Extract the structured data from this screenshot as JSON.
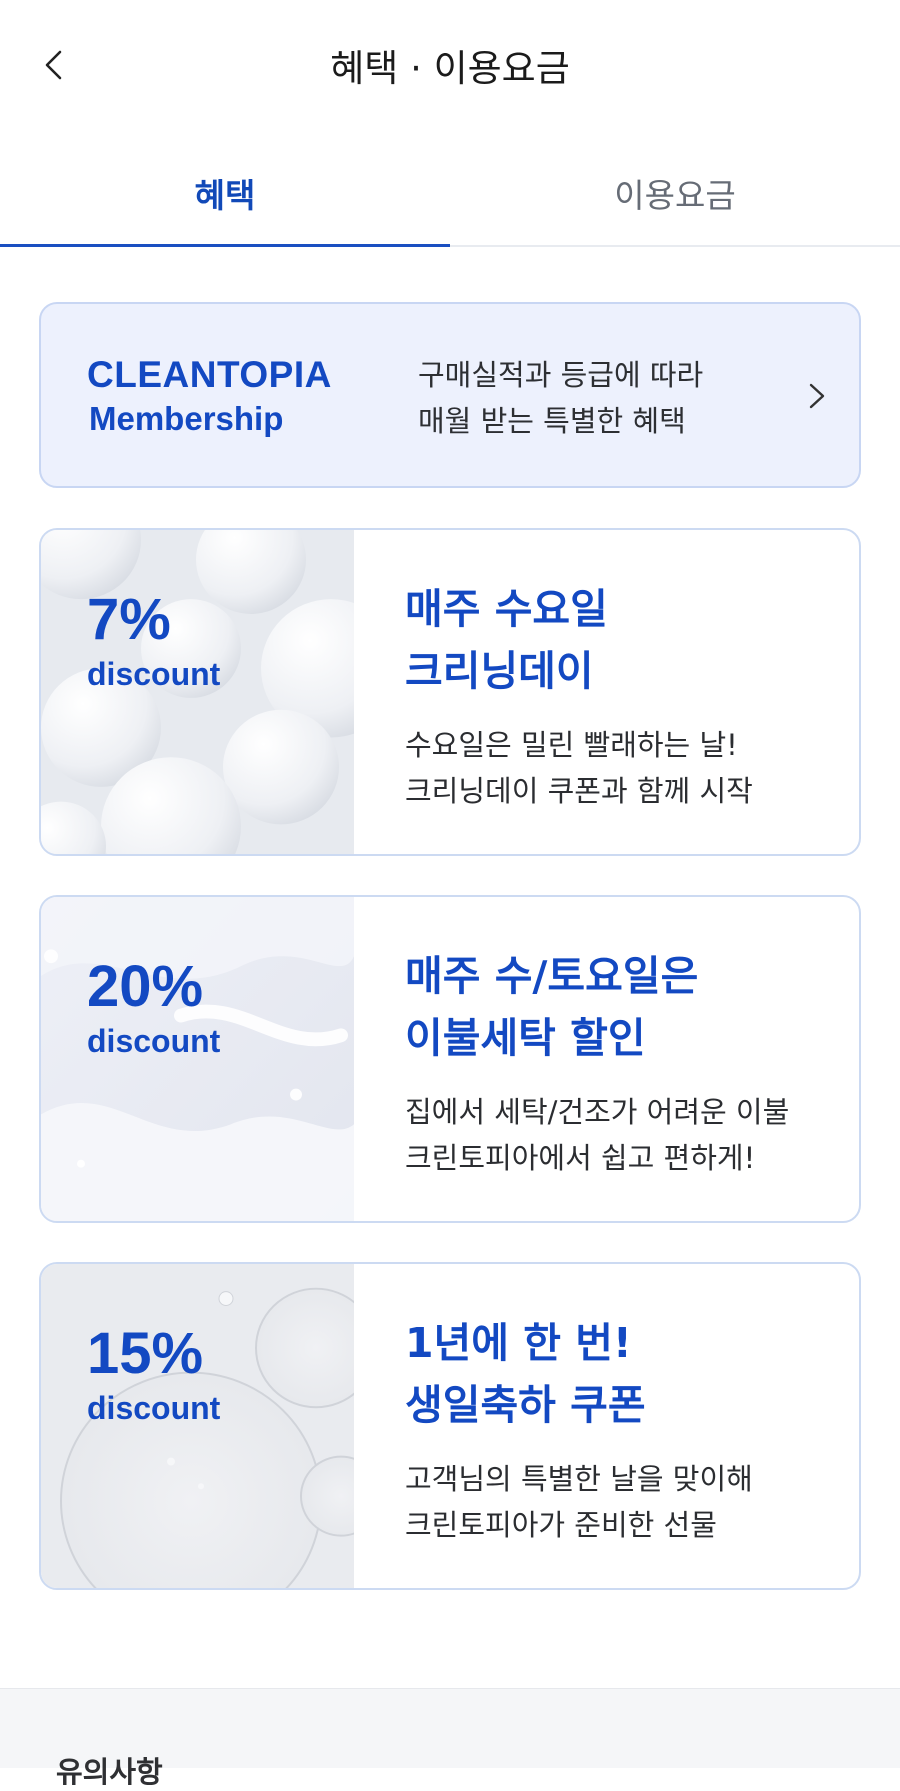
{
  "header": {
    "title": "혜택 · 이용요금",
    "back_icon": "chevron-left-icon"
  },
  "tabs": [
    {
      "label": "혜택",
      "active": true
    },
    {
      "label": "이용요금",
      "active": false
    }
  ],
  "membership": {
    "brand_line1": "CLEANTOPIA",
    "brand_line2": "Membership",
    "desc_line1": "구매실적과 등급에 따라",
    "desc_line2": "매월 받는 특별한 혜택",
    "chevron_icon": "chevron-right-icon"
  },
  "cards": [
    {
      "percent": "7%",
      "discount_label": "discount",
      "title_line1": "매주 수요일",
      "title_line2": "크리닝데이",
      "desc_line1": "수요일은 밀린 빨래하는 날!",
      "desc_line2": "크리닝데이 쿠폰과 함께 시작"
    },
    {
      "percent": "20%",
      "discount_label": "discount",
      "title_line1": "매주 수/토요일은",
      "title_line2": "이불세탁 할인",
      "desc_line1": "집에서 세탁/건조가 어려운 이불",
      "desc_line2": "크린토피아에서 쉽고 편하게!"
    },
    {
      "percent": "15%",
      "discount_label": "discount",
      "title_line1": "1년에 한 번!",
      "title_line2": "생일축하 쿠폰",
      "desc_line1": "고객님의 특별한 날을 맞이해",
      "desc_line2": "크린토피아가 준비한 선물"
    }
  ],
  "notice": {
    "title": "유의사항"
  },
  "colors": {
    "accent": "#1349c2",
    "membership_bg": "#edf1fd",
    "card_border": "#ccdaf2"
  }
}
